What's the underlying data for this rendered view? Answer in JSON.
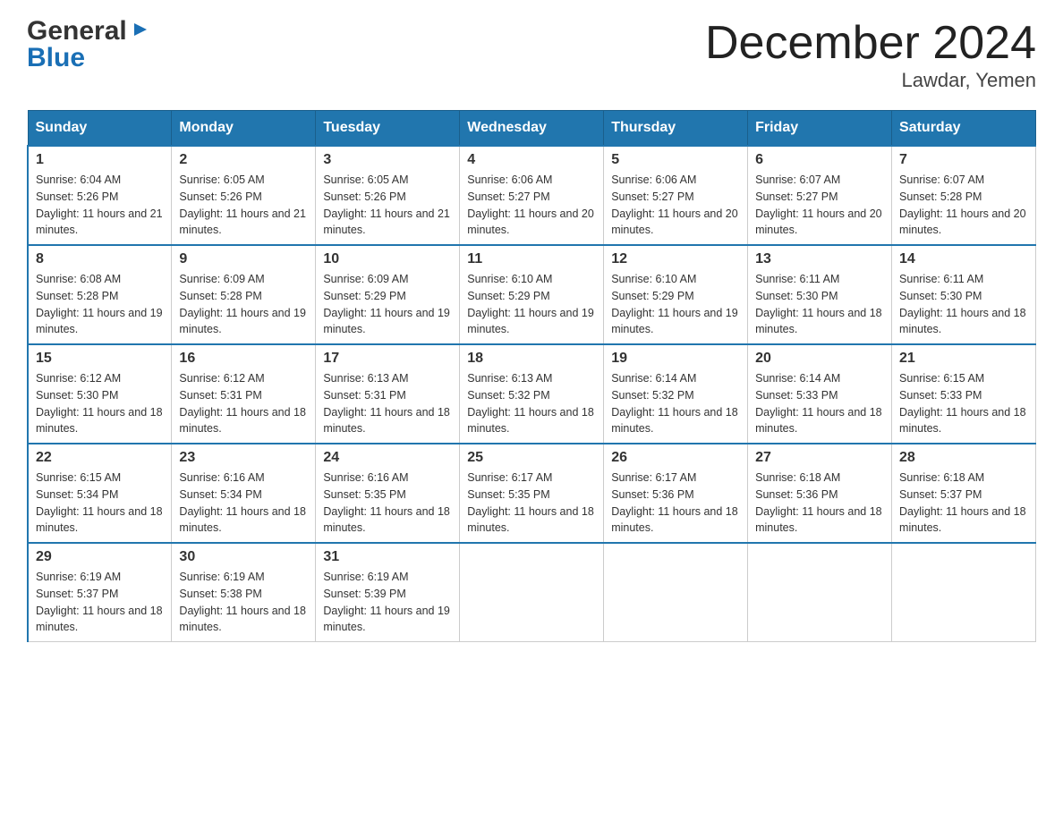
{
  "header": {
    "logo_general": "General",
    "logo_blue": "Blue",
    "month_title": "December 2024",
    "location": "Lawdar, Yemen"
  },
  "days_of_week": [
    "Sunday",
    "Monday",
    "Tuesday",
    "Wednesday",
    "Thursday",
    "Friday",
    "Saturday"
  ],
  "weeks": [
    [
      {
        "day": "1",
        "sunrise": "6:04 AM",
        "sunset": "5:26 PM",
        "daylight": "11 hours and 21 minutes."
      },
      {
        "day": "2",
        "sunrise": "6:05 AM",
        "sunset": "5:26 PM",
        "daylight": "11 hours and 21 minutes."
      },
      {
        "day": "3",
        "sunrise": "6:05 AM",
        "sunset": "5:26 PM",
        "daylight": "11 hours and 21 minutes."
      },
      {
        "day": "4",
        "sunrise": "6:06 AM",
        "sunset": "5:27 PM",
        "daylight": "11 hours and 20 minutes."
      },
      {
        "day": "5",
        "sunrise": "6:06 AM",
        "sunset": "5:27 PM",
        "daylight": "11 hours and 20 minutes."
      },
      {
        "day": "6",
        "sunrise": "6:07 AM",
        "sunset": "5:27 PM",
        "daylight": "11 hours and 20 minutes."
      },
      {
        "day": "7",
        "sunrise": "6:07 AM",
        "sunset": "5:28 PM",
        "daylight": "11 hours and 20 minutes."
      }
    ],
    [
      {
        "day": "8",
        "sunrise": "6:08 AM",
        "sunset": "5:28 PM",
        "daylight": "11 hours and 19 minutes."
      },
      {
        "day": "9",
        "sunrise": "6:09 AM",
        "sunset": "5:28 PM",
        "daylight": "11 hours and 19 minutes."
      },
      {
        "day": "10",
        "sunrise": "6:09 AM",
        "sunset": "5:29 PM",
        "daylight": "11 hours and 19 minutes."
      },
      {
        "day": "11",
        "sunrise": "6:10 AM",
        "sunset": "5:29 PM",
        "daylight": "11 hours and 19 minutes."
      },
      {
        "day": "12",
        "sunrise": "6:10 AM",
        "sunset": "5:29 PM",
        "daylight": "11 hours and 19 minutes."
      },
      {
        "day": "13",
        "sunrise": "6:11 AM",
        "sunset": "5:30 PM",
        "daylight": "11 hours and 18 minutes."
      },
      {
        "day": "14",
        "sunrise": "6:11 AM",
        "sunset": "5:30 PM",
        "daylight": "11 hours and 18 minutes."
      }
    ],
    [
      {
        "day": "15",
        "sunrise": "6:12 AM",
        "sunset": "5:30 PM",
        "daylight": "11 hours and 18 minutes."
      },
      {
        "day": "16",
        "sunrise": "6:12 AM",
        "sunset": "5:31 PM",
        "daylight": "11 hours and 18 minutes."
      },
      {
        "day": "17",
        "sunrise": "6:13 AM",
        "sunset": "5:31 PM",
        "daylight": "11 hours and 18 minutes."
      },
      {
        "day": "18",
        "sunrise": "6:13 AM",
        "sunset": "5:32 PM",
        "daylight": "11 hours and 18 minutes."
      },
      {
        "day": "19",
        "sunrise": "6:14 AM",
        "sunset": "5:32 PM",
        "daylight": "11 hours and 18 minutes."
      },
      {
        "day": "20",
        "sunrise": "6:14 AM",
        "sunset": "5:33 PM",
        "daylight": "11 hours and 18 minutes."
      },
      {
        "day": "21",
        "sunrise": "6:15 AM",
        "sunset": "5:33 PM",
        "daylight": "11 hours and 18 minutes."
      }
    ],
    [
      {
        "day": "22",
        "sunrise": "6:15 AM",
        "sunset": "5:34 PM",
        "daylight": "11 hours and 18 minutes."
      },
      {
        "day": "23",
        "sunrise": "6:16 AM",
        "sunset": "5:34 PM",
        "daylight": "11 hours and 18 minutes."
      },
      {
        "day": "24",
        "sunrise": "6:16 AM",
        "sunset": "5:35 PM",
        "daylight": "11 hours and 18 minutes."
      },
      {
        "day": "25",
        "sunrise": "6:17 AM",
        "sunset": "5:35 PM",
        "daylight": "11 hours and 18 minutes."
      },
      {
        "day": "26",
        "sunrise": "6:17 AM",
        "sunset": "5:36 PM",
        "daylight": "11 hours and 18 minutes."
      },
      {
        "day": "27",
        "sunrise": "6:18 AM",
        "sunset": "5:36 PM",
        "daylight": "11 hours and 18 minutes."
      },
      {
        "day": "28",
        "sunrise": "6:18 AM",
        "sunset": "5:37 PM",
        "daylight": "11 hours and 18 minutes."
      }
    ],
    [
      {
        "day": "29",
        "sunrise": "6:19 AM",
        "sunset": "5:37 PM",
        "daylight": "11 hours and 18 minutes."
      },
      {
        "day": "30",
        "sunrise": "6:19 AM",
        "sunset": "5:38 PM",
        "daylight": "11 hours and 18 minutes."
      },
      {
        "day": "31",
        "sunrise": "6:19 AM",
        "sunset": "5:39 PM",
        "daylight": "11 hours and 19 minutes."
      },
      null,
      null,
      null,
      null
    ]
  ]
}
